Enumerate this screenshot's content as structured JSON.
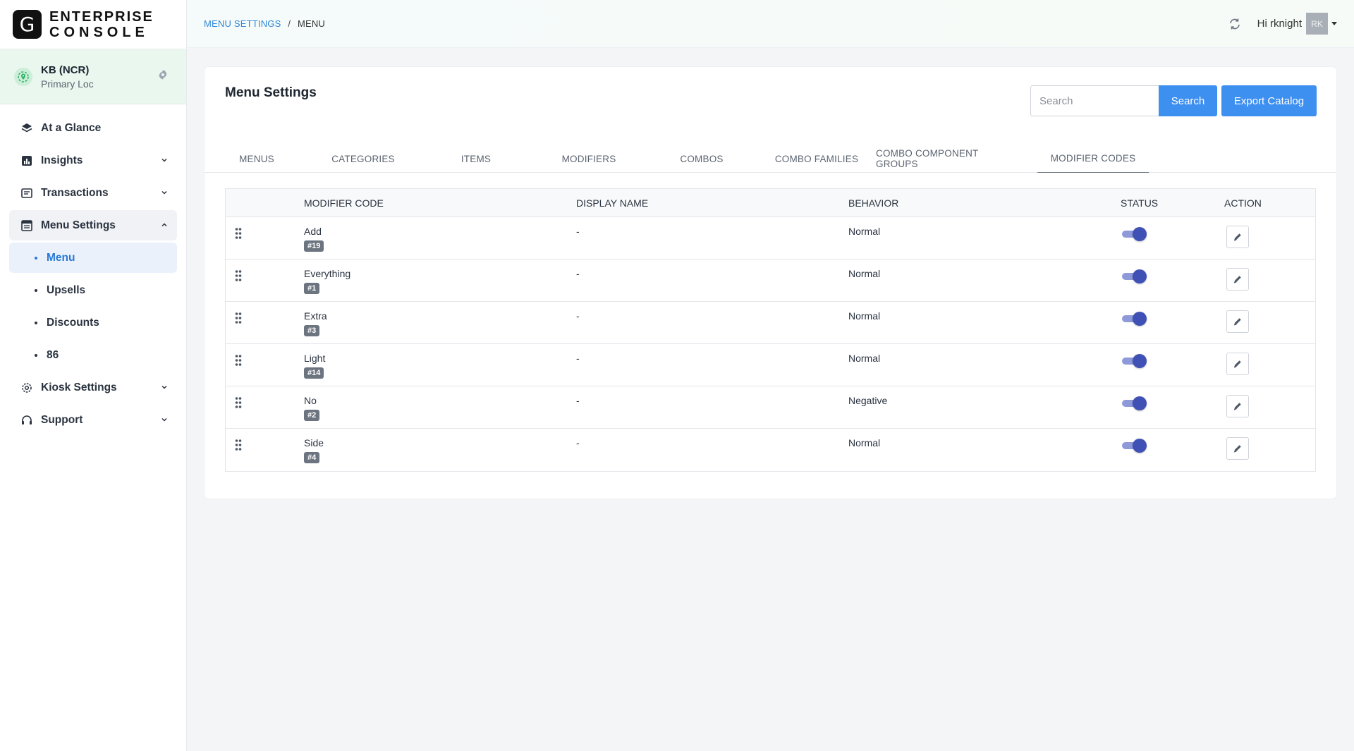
{
  "brand": {
    "logo_letter": "G",
    "line1": "ENTERPRISE",
    "line2": "CONSOLE"
  },
  "location": {
    "name": "KB (NCR)",
    "subtitle": "Primary Loc"
  },
  "sidebar": {
    "items": [
      {
        "label": "At a Glance",
        "icon": "layers-icon"
      },
      {
        "label": "Insights",
        "icon": "chart-icon"
      },
      {
        "label": "Transactions",
        "icon": "receipt-icon"
      },
      {
        "label": "Menu Settings",
        "icon": "menu-card-icon"
      },
      {
        "label": "Kiosk Settings",
        "icon": "gear-icon"
      },
      {
        "label": "Support",
        "icon": "headset-icon"
      }
    ],
    "sub_items": [
      {
        "label": "Menu"
      },
      {
        "label": "Upsells"
      },
      {
        "label": "Discounts"
      },
      {
        "label": "86"
      }
    ]
  },
  "breadcrumb": {
    "parent": "MENU SETTINGS",
    "separator": "/",
    "current": "MENU"
  },
  "user": {
    "greeting": "Hi rknight",
    "initials": "RK"
  },
  "page": {
    "title": "Menu Settings",
    "search_placeholder": "Search",
    "search_button": "Search",
    "export_button": "Export Catalog"
  },
  "tabs": [
    "MENUS",
    "CATEGORIES",
    "ITEMS",
    "MODIFIERS",
    "COMBOS",
    "COMBO FAMILIES",
    "COMBO COMPONENT GROUPS",
    "MODIFIER CODES"
  ],
  "active_tab": "MODIFIER CODES",
  "table": {
    "headers": {
      "code": "MODIFIER CODE",
      "display": "DISPLAY NAME",
      "behavior": "BEHAVIOR",
      "status": "STATUS",
      "action": "ACTION"
    },
    "rows": [
      {
        "name": "Add",
        "code": "#19",
        "display": "-",
        "behavior": "Normal",
        "enabled": true
      },
      {
        "name": "Everything",
        "code": "#1",
        "display": "-",
        "behavior": "Normal",
        "enabled": true
      },
      {
        "name": "Extra",
        "code": "#3",
        "display": "-",
        "behavior": "Normal",
        "enabled": true
      },
      {
        "name": "Light",
        "code": "#14",
        "display": "-",
        "behavior": "Normal",
        "enabled": true
      },
      {
        "name": "No",
        "code": "#2",
        "display": "-",
        "behavior": "Negative",
        "enabled": true
      },
      {
        "name": "Side",
        "code": "#4",
        "display": "-",
        "behavior": "Normal",
        "enabled": true
      }
    ]
  },
  "colors": {
    "accent": "#3d8ff0",
    "toggle_on": "#3f51b5",
    "active_nav": "#2878d6"
  }
}
